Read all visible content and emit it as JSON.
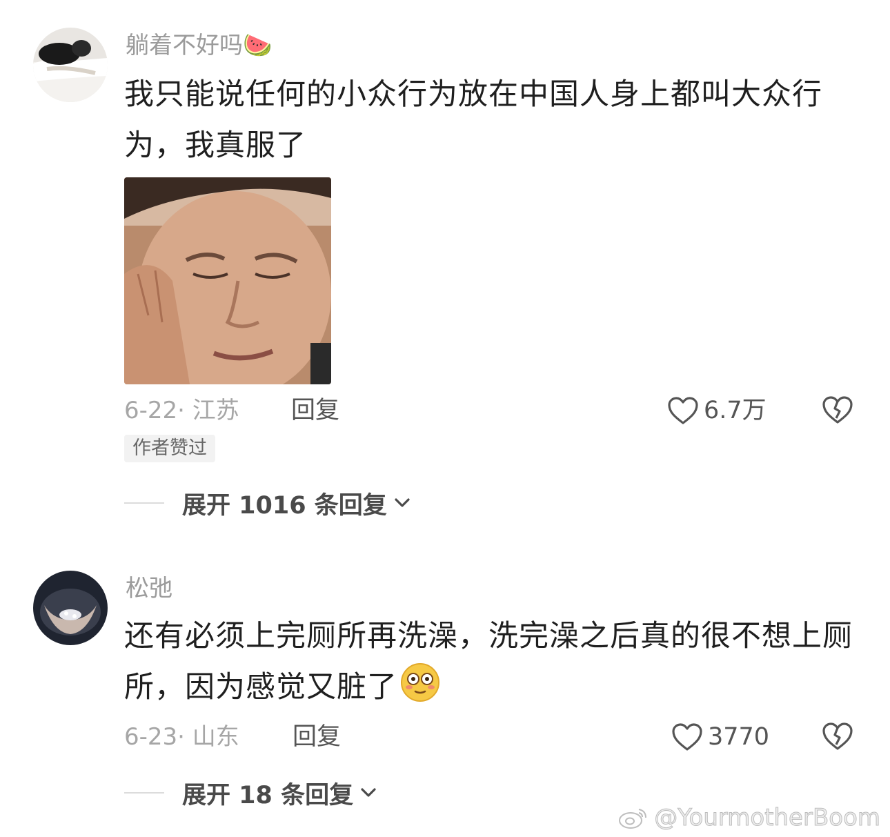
{
  "comments": [
    {
      "username": "躺着不好吗",
      "username_emoji": "🍉",
      "text": "我只能说任何的小众行为放在中国人身上都叫大众行为，我真服了",
      "date_location": "6-22· 江苏",
      "reply_label": "回复",
      "likes": "6.7万",
      "author_badge": "作者赞过",
      "expand_label": "展开 1016 条回复",
      "avatar_icon": "person-lying-on-bed-avatar",
      "sticker_icon": "man-closed-eyes-sticker"
    },
    {
      "username": "松弛",
      "text": "还有必须上完厕所再洗澡，洗完澡之后真的很不想上厕所，因为感觉又脏了",
      "text_emoji": "😳",
      "date_location": "6-23· 山东",
      "reply_label": "回复",
      "likes": "3770",
      "expand_label": "展开 18 条回复",
      "avatar_icon": "cupped-hands-avatar"
    }
  ],
  "watermark": "@YourmotherBoom",
  "colors": {
    "username": "#9b9b9b",
    "text": "#1f1f1f",
    "meta": "#a6a6a6",
    "action": "#555555"
  }
}
